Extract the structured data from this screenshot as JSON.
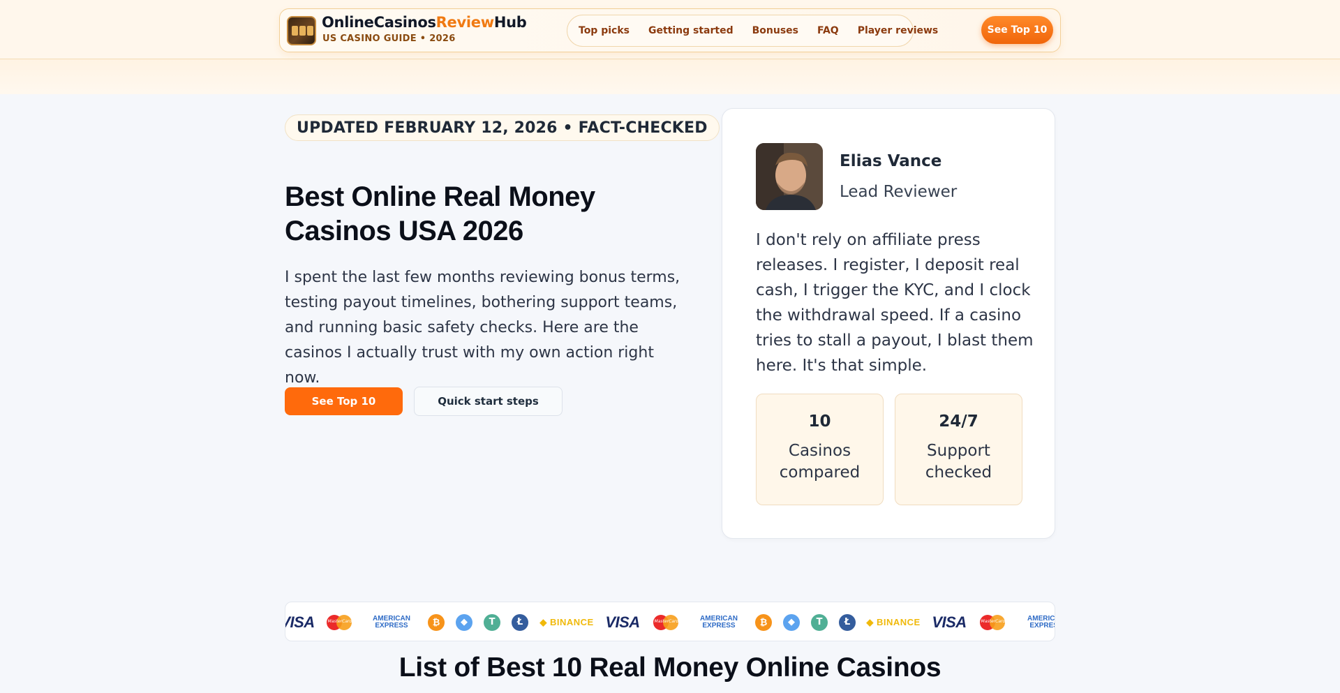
{
  "header": {
    "logo_part1": "OnlineCasinos",
    "logo_part2": "Review",
    "logo_part3": "Hub",
    "tagline": "US CASINO GUIDE • 2026",
    "nav": [
      "Top picks",
      "Getting started",
      "Bonuses",
      "FAQ",
      "Player reviews"
    ],
    "cta": "See Top 10"
  },
  "hero": {
    "updated": "UPDATED FEBRUARY 12, 2026 • FACT-CHECKED",
    "title": "Best Online Real Money Casinos USA 2026",
    "intro": "I spent the last few months reviewing bonus terms, testing payout timelines, bothering support teams, and running basic safety checks. Here are the casinos I actually trust with my own action right now.",
    "primary_button": "See Top 10",
    "secondary_button": "Quick start steps"
  },
  "reviewer": {
    "name": "Elias Vance",
    "role": "Lead Reviewer",
    "quote": "I don't rely on affiliate press releases. I register, I deposit real cash, I trigger the KYC, and I clock the withdrawal speed. If a casino tries to stall a payout, I blast them here. It's that simple.",
    "stats": [
      {
        "value": "10",
        "label": "Casinos compared"
      },
      {
        "value": "24/7",
        "label": "Support checked"
      }
    ]
  },
  "payments": {
    "visa": "VISA",
    "mastercard": "MasterCard",
    "amex_line1": "AMERICAN",
    "amex_line2": "EXPRESS",
    "binance": "BINANCE",
    "btc_symbol": "₿",
    "eth_symbol": "◆",
    "usdt_symbol": "T",
    "ltc_symbol": "Ł"
  },
  "list_title": "List of Best 10 Real Money Online Casinos",
  "colors": {
    "accent_orange": "#ff6a0c",
    "brand_orange": "#f07a12",
    "nav_text": "#8b3a0e"
  }
}
